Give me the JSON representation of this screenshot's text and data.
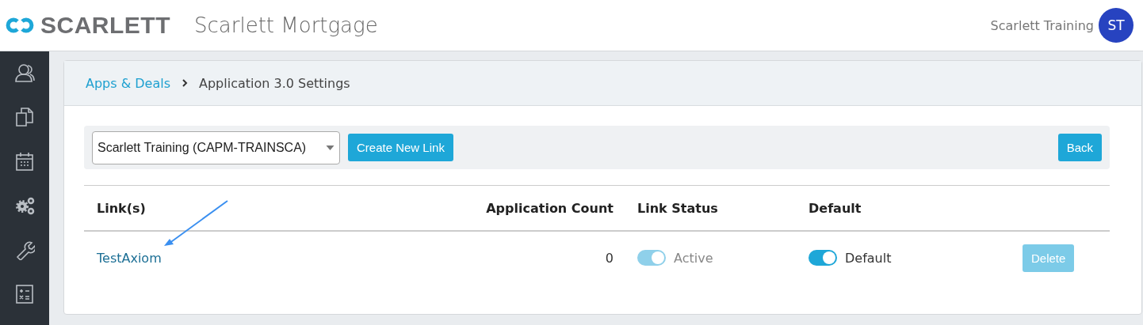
{
  "header": {
    "brand": "SCARLETT",
    "app_title": "Scarlett Mortgage",
    "user_name": "Scarlett Training",
    "avatar_initials": "ST"
  },
  "breadcrumb": [
    {
      "label": "Apps & Deals",
      "kind": "link"
    },
    {
      "label": "Application 3.0 Settings",
      "kind": "current"
    }
  ],
  "toolbar": {
    "branch_select": {
      "value": "Scarlett Training (CAPM-TRAINSCA)"
    },
    "create_button": "Create New Link",
    "back_button": "Back"
  },
  "table": {
    "columns": [
      "Link(s)",
      "Application Count",
      "Link Status",
      "Default"
    ],
    "rows": [
      {
        "link": "TestAxiom",
        "application_count": "0",
        "status": {
          "label": "Active",
          "on": true,
          "disabled": true
        },
        "default": {
          "label": "Default",
          "on": true,
          "disabled": false
        },
        "delete": {
          "label": "Delete",
          "disabled": true
        }
      }
    ]
  }
}
